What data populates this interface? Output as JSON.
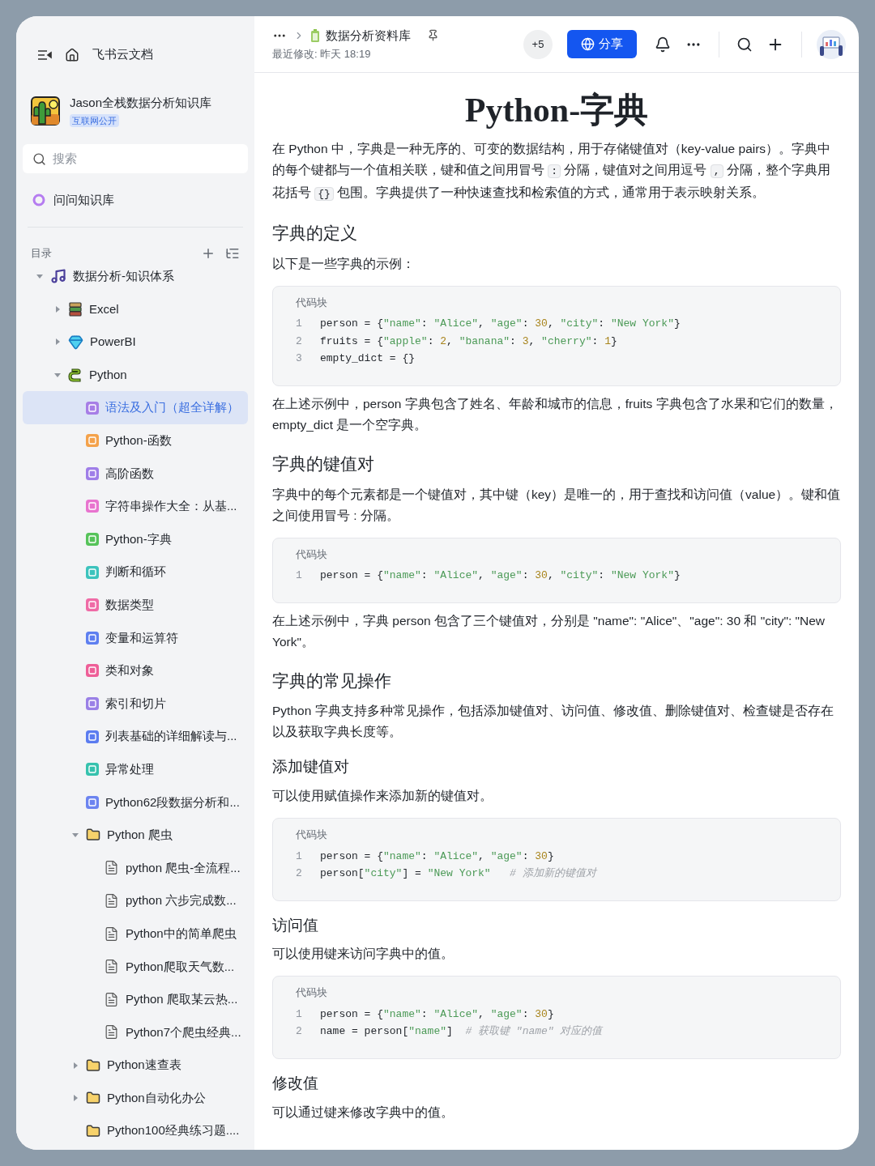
{
  "sidebar": {
    "app_title": "飞书云文档",
    "workspace": {
      "name": "Jason全栈数据分析知识库",
      "badge": "互联网公开"
    },
    "search": {
      "placeholder": "搜索"
    },
    "ask": {
      "label": "问问知识库"
    },
    "toc": {
      "label": "目录"
    },
    "tree": [
      {
        "label": "数据分析-知识体系",
        "kind": "music",
        "expanded": true,
        "selected": false,
        "children": [
          {
            "label": "Excel",
            "kind": "sheet",
            "expanded": false,
            "selected": false
          },
          {
            "label": "PowerBI",
            "kind": "gem",
            "expanded": false,
            "selected": false
          },
          {
            "label": "Python",
            "kind": "snake",
            "expanded": true,
            "selected": false,
            "children": [
              {
                "label": "语法及入门（超全详解）",
                "kind": "doc",
                "color": "#a77ee6",
                "selected": true
              },
              {
                "label": "Python-函数",
                "kind": "doc",
                "color": "#f4a24b",
                "selected": false
              },
              {
                "label": "高阶函数",
                "kind": "doc",
                "color": "#9f7ee8",
                "selected": false
              },
              {
                "label": "字符串操作大全：从基...",
                "kind": "doc",
                "color": "#e874cf",
                "selected": false
              },
              {
                "label": "Python-字典",
                "kind": "doc",
                "color": "#56c35a",
                "selected": false
              },
              {
                "label": "判断和循环",
                "kind": "doc",
                "color": "#3cc3bd",
                "selected": false
              },
              {
                "label": "数据类型",
                "kind": "doc",
                "color": "#ef6ba6",
                "selected": false
              },
              {
                "label": "变量和运算符",
                "kind": "doc",
                "color": "#5e7ff0",
                "selected": false
              },
              {
                "label": "类和对象",
                "kind": "doc",
                "color": "#ee5f98",
                "selected": false
              },
              {
                "label": "索引和切片",
                "kind": "doc",
                "color": "#9a80e6",
                "selected": false
              },
              {
                "label": "列表基础的详细解读与...",
                "kind": "doc",
                "color": "#5b7cf0",
                "selected": false
              },
              {
                "label": "异常处理",
                "kind": "doc",
                "color": "#36c2ae",
                "selected": false
              },
              {
                "label": "Python62段数据分析和...",
                "kind": "doc",
                "color": "#6c84f0",
                "selected": false
              },
              {
                "label": "Python 爬虫",
                "kind": "folder",
                "expanded": true,
                "selected": false,
                "children": [
                  {
                    "label": "python 爬虫-全流程...",
                    "kind": "page",
                    "selected": false
                  },
                  {
                    "label": "python 六步完成数...",
                    "kind": "page",
                    "selected": false
                  },
                  {
                    "label": "Python中的简单爬虫",
                    "kind": "page",
                    "selected": false
                  },
                  {
                    "label": "Python爬取天气数...",
                    "kind": "page",
                    "selected": false
                  },
                  {
                    "label": "Python 爬取某云热...",
                    "kind": "page",
                    "selected": false
                  },
                  {
                    "label": "Python7个爬虫经典...",
                    "kind": "page",
                    "selected": false
                  }
                ]
              },
              {
                "label": "Python速查表",
                "kind": "folder",
                "expanded": false,
                "selected": false
              },
              {
                "label": "Python自动化办公",
                "kind": "folder",
                "expanded": false,
                "selected": false
              },
              {
                "label": "Python100经典练习题....",
                "kind": "folder",
                "selected": false
              }
            ]
          }
        ]
      }
    ]
  },
  "topbar": {
    "title": "数据分析资料库",
    "modified": "最近修改: 昨天 18:19",
    "collaborators": "+5",
    "share": "分享"
  },
  "doc": {
    "title": "Python-字典",
    "blocks": [
      {
        "kind": "paragraph",
        "parts": [
          {
            "kind": "text",
            "text": "在 Python 中，字典是一种无序的、可变的数据结构，用于存储键值对（key-value pairs）。字典中的每个键都与一个值相关联，键和值之间用冒号 "
          },
          {
            "kind": "code",
            "text": ":"
          },
          {
            "kind": "text",
            "text": " 分隔，键值对之间用逗号 "
          },
          {
            "kind": "code",
            "text": ","
          },
          {
            "kind": "text",
            "text": " 分隔，整个字典用花括号 "
          },
          {
            "kind": "code",
            "text": "{}"
          },
          {
            "kind": "text",
            "text": " 包围。字典提供了一种快速查找和检索值的方式，通常用于表示映射关系。"
          }
        ]
      },
      {
        "kind": "heading2",
        "text": "字典的定义"
      },
      {
        "kind": "paragraph",
        "parts": [
          {
            "kind": "text",
            "text": "以下是一些字典的示例："
          }
        ]
      },
      {
        "kind": "code",
        "label": "代码块",
        "lines": [
          {
            "number": "1",
            "tokens": [
              {
                "kind": "plain",
                "text": "person = {"
              },
              {
                "kind": "string",
                "text": "\"name\""
              },
              {
                "kind": "plain",
                "text": ": "
              },
              {
                "kind": "string",
                "text": "\"Alice\""
              },
              {
                "kind": "plain",
                "text": ", "
              },
              {
                "kind": "string",
                "text": "\"age\""
              },
              {
                "kind": "plain",
                "text": ": "
              },
              {
                "kind": "number",
                "text": "30"
              },
              {
                "kind": "plain",
                "text": ", "
              },
              {
                "kind": "string",
                "text": "\"city\""
              },
              {
                "kind": "plain",
                "text": ": "
              },
              {
                "kind": "string",
                "text": "\"New York\""
              },
              {
                "kind": "plain",
                "text": "}"
              }
            ]
          },
          {
            "number": "2",
            "tokens": [
              {
                "kind": "plain",
                "text": "fruits = {"
              },
              {
                "kind": "string",
                "text": "\"apple\""
              },
              {
                "kind": "plain",
                "text": ": "
              },
              {
                "kind": "number",
                "text": "2"
              },
              {
                "kind": "plain",
                "text": ", "
              },
              {
                "kind": "string",
                "text": "\"banana\""
              },
              {
                "kind": "plain",
                "text": ": "
              },
              {
                "kind": "number",
                "text": "3"
              },
              {
                "kind": "plain",
                "text": ", "
              },
              {
                "kind": "string",
                "text": "\"cherry\""
              },
              {
                "kind": "plain",
                "text": ": "
              },
              {
                "kind": "number",
                "text": "1"
              },
              {
                "kind": "plain",
                "text": "}"
              }
            ]
          },
          {
            "number": "3",
            "tokens": [
              {
                "kind": "plain",
                "text": "empty_dict = {}"
              }
            ]
          }
        ]
      },
      {
        "kind": "paragraph",
        "parts": [
          {
            "kind": "text",
            "text": "在上述示例中，person 字典包含了姓名、年龄和城市的信息，fruits 字典包含了水果和它们的数量，empty_dict 是一个空字典。"
          }
        ]
      },
      {
        "kind": "heading2",
        "text": "字典的键值对"
      },
      {
        "kind": "paragraph",
        "parts": [
          {
            "kind": "text",
            "text": "字典中的每个元素都是一个键值对，其中键（key）是唯一的，用于查找和访问值（value）。键和值之间使用冒号 : 分隔。"
          }
        ]
      },
      {
        "kind": "code",
        "label": "代码块",
        "lines": [
          {
            "number": "1",
            "tokens": [
              {
                "kind": "plain",
                "text": "person = {"
              },
              {
                "kind": "string",
                "text": "\"name\""
              },
              {
                "kind": "plain",
                "text": ": "
              },
              {
                "kind": "string",
                "text": "\"Alice\""
              },
              {
                "kind": "plain",
                "text": ", "
              },
              {
                "kind": "string",
                "text": "\"age\""
              },
              {
                "kind": "plain",
                "text": ": "
              },
              {
                "kind": "number",
                "text": "30"
              },
              {
                "kind": "plain",
                "text": ", "
              },
              {
                "kind": "string",
                "text": "\"city\""
              },
              {
                "kind": "plain",
                "text": ": "
              },
              {
                "kind": "string",
                "text": "\"New York\""
              },
              {
                "kind": "plain",
                "text": "}"
              }
            ]
          }
        ]
      },
      {
        "kind": "paragraph",
        "parts": [
          {
            "kind": "text",
            "text": "在上述示例中，字典 person 包含了三个键值对，分别是 \"name\": \"Alice\"、\"age\": 30 和 \"city\": \"New York\"。"
          }
        ]
      },
      {
        "kind": "heading2",
        "text": "字典的常见操作"
      },
      {
        "kind": "paragraph",
        "parts": [
          {
            "kind": "text",
            "text": "Python 字典支持多种常见操作，包括添加键值对、访问值、修改值、删除键值对、检查键是否存在以及获取字典长度等。"
          }
        ]
      },
      {
        "kind": "heading3",
        "text": "添加键值对"
      },
      {
        "kind": "paragraph",
        "parts": [
          {
            "kind": "text",
            "text": "可以使用赋值操作来添加新的键值对。"
          }
        ]
      },
      {
        "kind": "code",
        "label": "代码块",
        "lines": [
          {
            "number": "1",
            "tokens": [
              {
                "kind": "plain",
                "text": "person = {"
              },
              {
                "kind": "string",
                "text": "\"name\""
              },
              {
                "kind": "plain",
                "text": ": "
              },
              {
                "kind": "string",
                "text": "\"Alice\""
              },
              {
                "kind": "plain",
                "text": ", "
              },
              {
                "kind": "string",
                "text": "\"age\""
              },
              {
                "kind": "plain",
                "text": ": "
              },
              {
                "kind": "number",
                "text": "30"
              },
              {
                "kind": "plain",
                "text": "}"
              }
            ]
          },
          {
            "number": "2",
            "tokens": [
              {
                "kind": "plain",
                "text": "person["
              },
              {
                "kind": "string",
                "text": "\"city\""
              },
              {
                "kind": "plain",
                "text": "] = "
              },
              {
                "kind": "string",
                "text": "\"New York\""
              },
              {
                "kind": "comment",
                "text": "   # 添加新的键值对"
              }
            ]
          }
        ]
      },
      {
        "kind": "heading3",
        "text": "访问值"
      },
      {
        "kind": "paragraph",
        "parts": [
          {
            "kind": "text",
            "text": "可以使用键来访问字典中的值。"
          }
        ]
      },
      {
        "kind": "code",
        "label": "代码块",
        "lines": [
          {
            "number": "1",
            "tokens": [
              {
                "kind": "plain",
                "text": "person = {"
              },
              {
                "kind": "string",
                "text": "\"name\""
              },
              {
                "kind": "plain",
                "text": ": "
              },
              {
                "kind": "string",
                "text": "\"Alice\""
              },
              {
                "kind": "plain",
                "text": ", "
              },
              {
                "kind": "string",
                "text": "\"age\""
              },
              {
                "kind": "plain",
                "text": ": "
              },
              {
                "kind": "number",
                "text": "30"
              },
              {
                "kind": "plain",
                "text": "}"
              }
            ]
          },
          {
            "number": "2",
            "tokens": [
              {
                "kind": "plain",
                "text": "name = person["
              },
              {
                "kind": "string",
                "text": "\"name\""
              },
              {
                "kind": "plain",
                "text": "]"
              },
              {
                "kind": "comment",
                "text": "  # 获取键 \"name\" 对应的值"
              }
            ]
          }
        ]
      },
      {
        "kind": "heading3",
        "text": "修改值"
      },
      {
        "kind": "paragraph",
        "parts": [
          {
            "kind": "text",
            "text": "可以通过键来修改字典中的值。"
          }
        ]
      }
    ]
  }
}
